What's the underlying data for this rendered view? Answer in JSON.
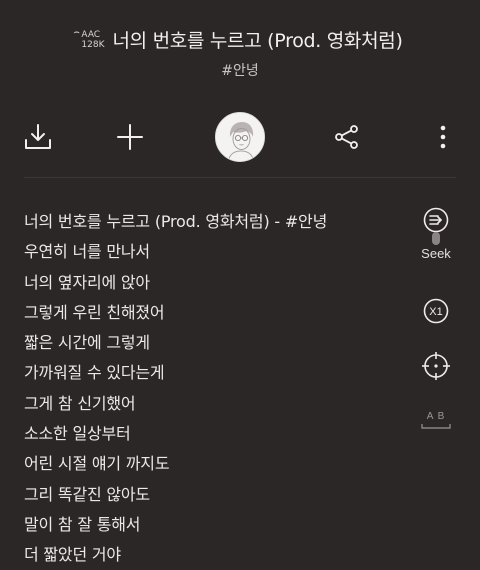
{
  "header": {
    "quality_format": "AAC",
    "quality_bitrate": "128K",
    "song_title": "너의 번호를 누르고 (Prod. 영화처럼)",
    "artist": "#안녕"
  },
  "toolbar": {
    "download_icon": "download-icon",
    "add_icon": "plus-icon",
    "share_icon": "share-icon",
    "more_icon": "more-vertical-icon"
  },
  "lyrics": [
    "너의 번호를 누르고 (Prod. 영화처럼) - #안녕",
    "우연히 너를 만나서",
    "너의 옆자리에 앉아",
    "그렇게 우린 친해졌어",
    "짧은 시간에 그렇게",
    "가까워질 수 있다는게",
    "그게 참 신기했어",
    "소소한 일상부터",
    "어린 시절 얘기 까지도",
    "그리 똑같진 않아도",
    "말이 참 잘 통해서",
    "더 짧았던 거야"
  ],
  "side_controls": {
    "seek_label": "Seek",
    "speed_label": "X1",
    "ab_label": "A B"
  },
  "colors": {
    "background": "#2b2727",
    "text": "#ebe7e6",
    "avatar_bg": "#f4f3f2"
  }
}
